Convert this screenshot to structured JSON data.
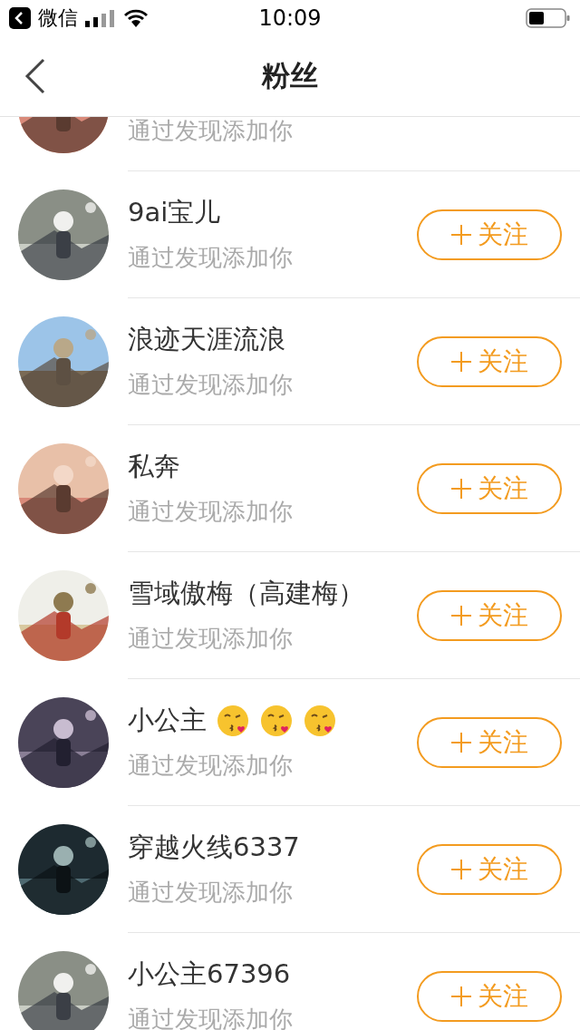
{
  "status_bar": {
    "back_app": "微信",
    "time": "10:09"
  },
  "nav": {
    "title": "粉丝"
  },
  "fans": [
    {
      "kind": "plain",
      "subtitle": "通过发现添加你"
    },
    {
      "kind": "plain",
      "name": "9ai宝儿",
      "subtitle": "通过发现添加你",
      "button": "关注"
    },
    {
      "kind": "plain",
      "name": "浪迹天涯流浪",
      "subtitle": "通过发现添加你",
      "button": "关注"
    },
    {
      "kind": "plain",
      "name": "私奔",
      "subtitle": "通过发现添加你",
      "button": "关注"
    },
    {
      "kind": "plain",
      "name": "雪域傲梅（高建梅）",
      "subtitle": "通过发现添加你",
      "button": "关注"
    },
    {
      "kind": "emoji",
      "name": "小公主",
      "subtitle": "通过发现添加你",
      "button": "关注"
    },
    {
      "kind": "plain",
      "name": "穿越火线6337",
      "subtitle": "通过发现添加你",
      "button": "关注"
    },
    {
      "kind": "plain",
      "name": "小公主67396",
      "subtitle": "通过发现添加你",
      "button": "关注"
    }
  ]
}
